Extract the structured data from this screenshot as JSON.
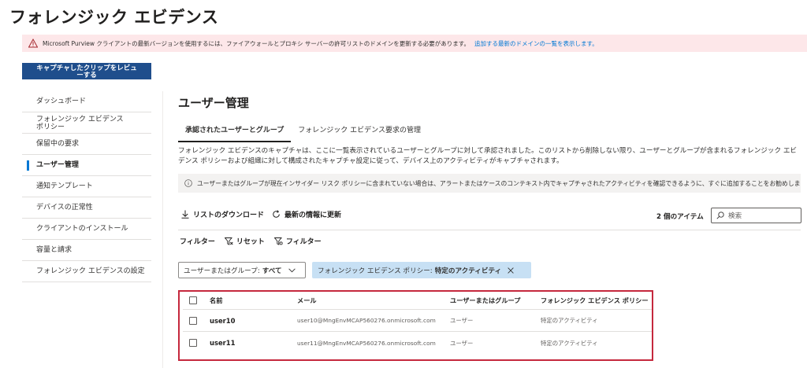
{
  "page": {
    "title": "フォレンジック エビデンス"
  },
  "banner": {
    "text": "Microsoft Purview クライアントの最新バージョンを使用するには、ファイアウォールとプロキシ サーバーの許可リストのドメインを更新する必要があります。",
    "link": "追加する最新のドメインの一覧を表示します。",
    "icon": "warning-icon"
  },
  "review_button": {
    "line1": "キャプチャしたクリップをレビュ",
    "line2": "ーする"
  },
  "sidebar": {
    "items": [
      {
        "label": "ダッシュボード"
      },
      {
        "label": "フォレンジック エビデンス ポリシー"
      },
      {
        "label": "保留中の要求"
      },
      {
        "label": "ユーザー管理",
        "active": true
      },
      {
        "label": "通知テンプレート"
      },
      {
        "label": "デバイスの正常性"
      },
      {
        "label": "クライアントのインストール"
      },
      {
        "label": "容量と請求"
      },
      {
        "label": "フォレンジック エビデンスの設定"
      }
    ]
  },
  "main": {
    "title": "ユーザー管理",
    "tabs": [
      {
        "label": "承認されたユーザーとグループ",
        "active": true
      },
      {
        "label": "フォレンジック エビデンス要求の管理"
      }
    ],
    "description": "フォレンジック エビデンスのキャプチャは、ここに一覧表示されているユーザーとグループに対して承認されました。このリストから削除しない限り、ユーザーとグループが含まれるフォレンジック エビデンス ポリシーおよび組織に対して構成されたキャプチャ設定に従って、デバイス上のアクティビティがキャプチャされます。",
    "info": "ユーザーまたはグループが現在インサイダー リスク ポリシーに含まれていない場合は、アラートまたはケースのコンテキスト内でキャプチャされたアクティビティを確認できるように、すぐに追加することをお勧めします。",
    "actions": {
      "download": "リストのダウンロード",
      "refresh": "最新の情報に更新"
    },
    "item_count": "2 個のアイテム",
    "search_placeholder": "検索",
    "filter_bar": {
      "label": "フィルター",
      "reset": "リセット",
      "filter": "フィルター"
    },
    "user_filter": {
      "label": "ユーザーまたはグループ:",
      "value": "すべて"
    },
    "policy_filter": {
      "label": "フォレンジック エビデンス ポリシー:",
      "value": "特定のアクティビティ"
    },
    "table": {
      "headers": {
        "name": "名前",
        "email": "メール",
        "type": "ユーザーまたはグループ",
        "policy": "フォレンジック エビデンス ポリシー"
      },
      "rows": [
        {
          "name": "user10",
          "email": "user10@MngEnvMCAP560276.onmicrosoft.com",
          "type": "ユーザー",
          "policy": "特定のアクティビティ"
        },
        {
          "name": "user11",
          "email": "user11@MngEnvMCAP560276.onmicrosoft.com",
          "type": "ユーザー",
          "policy": "特定のアクティビティ"
        }
      ]
    }
  },
  "colors": {
    "accent": "#0078d4",
    "banner_bg": "#fde7e9",
    "button_bg": "#1f4e8c",
    "highlight_border": "#c5283d",
    "pill_bg": "#c7e0f4"
  }
}
